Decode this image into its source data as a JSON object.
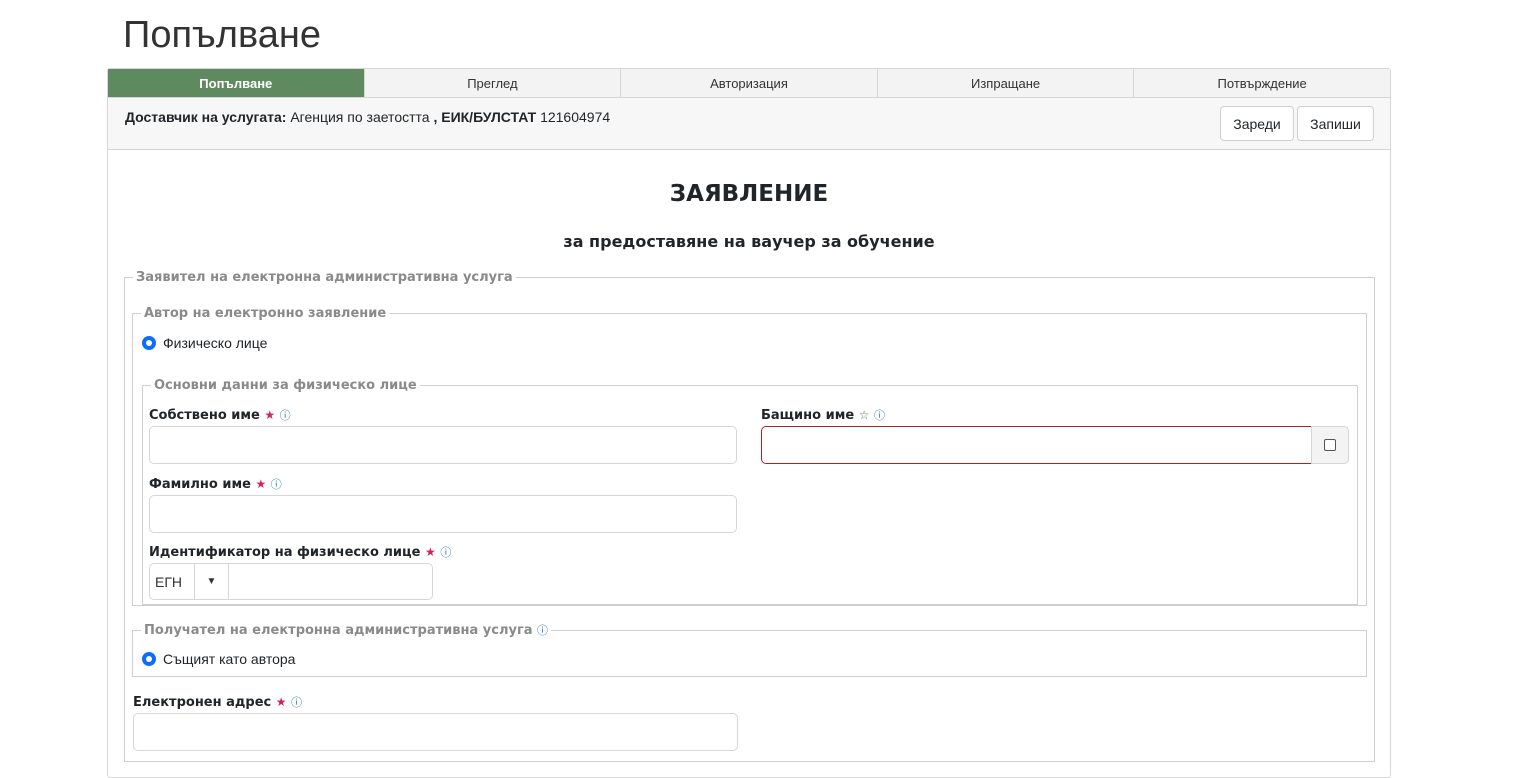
{
  "page": {
    "title": "Попълване"
  },
  "steps": [
    {
      "label": "Попълване",
      "active": true
    },
    {
      "label": "Преглед",
      "active": false
    },
    {
      "label": "Авторизация",
      "active": false
    },
    {
      "label": "Изпращане",
      "active": false
    },
    {
      "label": "Потвърждение",
      "active": false
    }
  ],
  "provider": {
    "label": "Доставчик на услугата:",
    "name": "Агенция по заетостта",
    "sep": ",",
    "id_label": "ЕИК/БУЛСТАТ",
    "id_value": "121604974"
  },
  "toolbar": {
    "load_label": "Зареди",
    "save_label": "Запиши"
  },
  "document": {
    "title": "ЗАЯВЛЕНИЕ",
    "subtitle": "за предоставяне на ваучер за обучение"
  },
  "applicant": {
    "legend": "Заявител на електронна административна услуга",
    "author": {
      "legend": "Автор на електронно заявление",
      "option": "Физическо лице"
    },
    "basic": {
      "legend": "Основни данни за физическо лице",
      "first_name": {
        "label": "Собствено име",
        "value": ""
      },
      "middle_name": {
        "label": "Бащино име",
        "value": ""
      },
      "last_name": {
        "label": "Фамилно име",
        "value": ""
      },
      "identifier": {
        "label": "Идентификатор на физическо лице",
        "type": "ЕГН",
        "value": ""
      }
    },
    "recipient": {
      "legend": "Получател на електронна административна услуга",
      "option": "Същият като автора"
    },
    "email": {
      "label": "Електронен адрес",
      "value": ""
    }
  },
  "icons": {
    "required": "★",
    "optional": "☆",
    "info": "ⓘ",
    "dropdown": "▼"
  },
  "colors": {
    "active_step": "#5f8a60",
    "required": "#d0245c",
    "radio": "#0d6efd",
    "invalid": "#b22222"
  }
}
